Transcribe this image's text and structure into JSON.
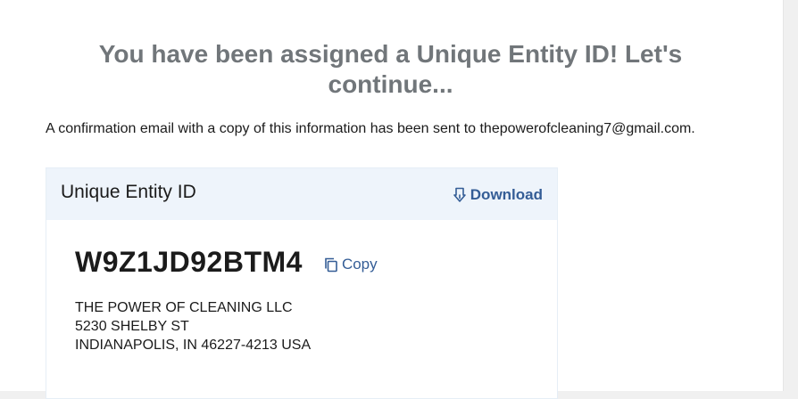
{
  "heading": "You have been assigned a Unique Entity ID! Let's continue...",
  "notice": "A confirmation email with a copy of this information has been sent to thepowerofcleaning7@gmail.com.",
  "card": {
    "title": "Unique Entity ID",
    "download_label": "Download",
    "uei": "W9Z1JD92BTM4",
    "copy_label": "Copy",
    "address": {
      "line1": "THE POWER OF CLEANING LLC",
      "line2": "5230 SHELBY ST",
      "line3": "INDIANAPOLIS, IN 46227-4213 USA"
    }
  },
  "icons": {
    "download": "download-icon",
    "copy": "copy-icon"
  },
  "colors": {
    "heading": "#71767a",
    "link": "#345d96",
    "card_header_bg": "#eef4fb",
    "text": "#1b1b1b"
  }
}
